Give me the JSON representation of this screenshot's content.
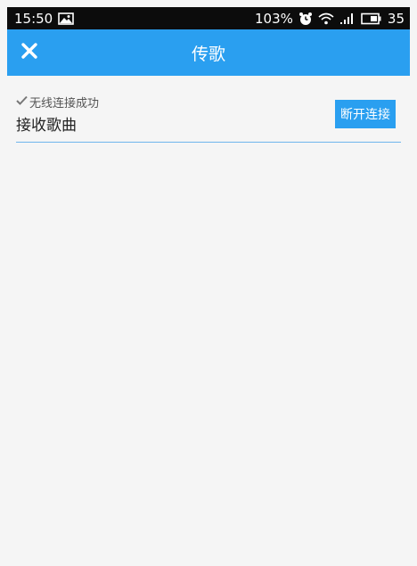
{
  "status_bar": {
    "time": "15:50",
    "battery_percent": "103%",
    "battery_level": "35",
    "icons": [
      "image-icon",
      "alarm-icon",
      "wifi-icon",
      "signal-icon",
      "battery-icon"
    ]
  },
  "header": {
    "title": "传歌",
    "close_icon": "close-icon",
    "background": "#2a9ff0"
  },
  "connection": {
    "status_text": "无线连接成功",
    "status_icon": "checkmark-icon",
    "receive_label": "接收歌曲",
    "disconnect_label": "断开连接"
  }
}
